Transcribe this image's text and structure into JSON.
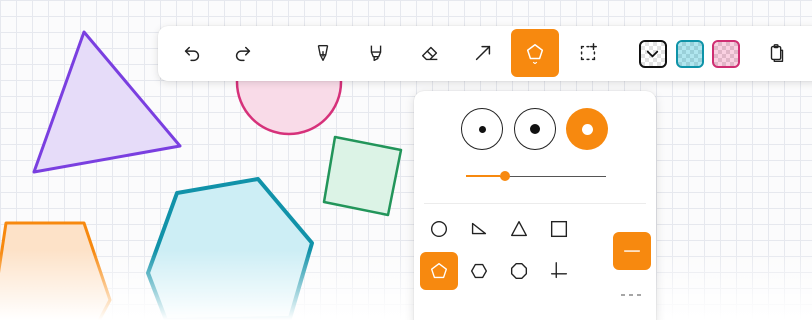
{
  "colors": {
    "accent": "#f7890f",
    "triangle_stroke": "#7a3fe0",
    "triangle_fill": "#e6dcf9",
    "circle_stroke": "#d6317a",
    "circle_fill": "#f9dbe8",
    "square_stroke": "#22955a",
    "square_fill": "#dcf3e6",
    "hexagon_stroke": "#1192a9",
    "hexagon_fill": "#cdeef5",
    "trapezoid_stroke": "#f7890f",
    "trapezoid_fill": "#fde2c8",
    "stroke_swatch": "#111111",
    "fill_swatch_cyan": "#0e93a8",
    "fill_swatch_pink": "#cf2e72",
    "grid_line": "#e6e8ee"
  },
  "toolbar": {
    "tools": [
      {
        "name": "undo",
        "icon": "undo-icon"
      },
      {
        "name": "redo",
        "icon": "redo-icon"
      },
      {
        "name": "pen",
        "icon": "pen-icon"
      },
      {
        "name": "highlighter",
        "icon": "highlighter-icon"
      },
      {
        "name": "eraser",
        "icon": "eraser-icon"
      },
      {
        "name": "arrow",
        "icon": "arrow-icon"
      },
      {
        "name": "shapes",
        "icon": "pentagon-icon",
        "active": true
      },
      {
        "name": "lasso-select",
        "icon": "lasso-select-icon"
      },
      {
        "name": "stroke-color",
        "icon": "stroke-swatch"
      },
      {
        "name": "fill-color-cyan",
        "icon": "fill-swatch"
      },
      {
        "name": "fill-color-pink",
        "icon": "fill-swatch"
      },
      {
        "name": "paste",
        "icon": "clipboard-icon"
      }
    ]
  },
  "shape_panel": {
    "stroke_sizes": [
      {
        "name": "small-outline",
        "style": "outline"
      },
      {
        "name": "medium-outline",
        "style": "outline"
      },
      {
        "name": "filled",
        "style": "filled",
        "active": true
      }
    ],
    "stroke_width_level": 0.25,
    "shapes": [
      {
        "name": "circle",
        "icon": "circle-icon"
      },
      {
        "name": "right-triangle",
        "icon": "right-triangle-icon"
      },
      {
        "name": "triangle",
        "icon": "triangle-icon"
      },
      {
        "name": "square",
        "icon": "square-icon"
      },
      {
        "name": "pentagon",
        "icon": "pentagon-icon",
        "active": true
      },
      {
        "name": "hexagon",
        "icon": "hexagon-icon"
      },
      {
        "name": "octagon",
        "icon": "octagon-icon"
      },
      {
        "name": "axes",
        "icon": "axes-icon"
      }
    ],
    "line_styles": [
      {
        "name": "solid",
        "active": true
      },
      {
        "name": "dashed"
      }
    ]
  }
}
